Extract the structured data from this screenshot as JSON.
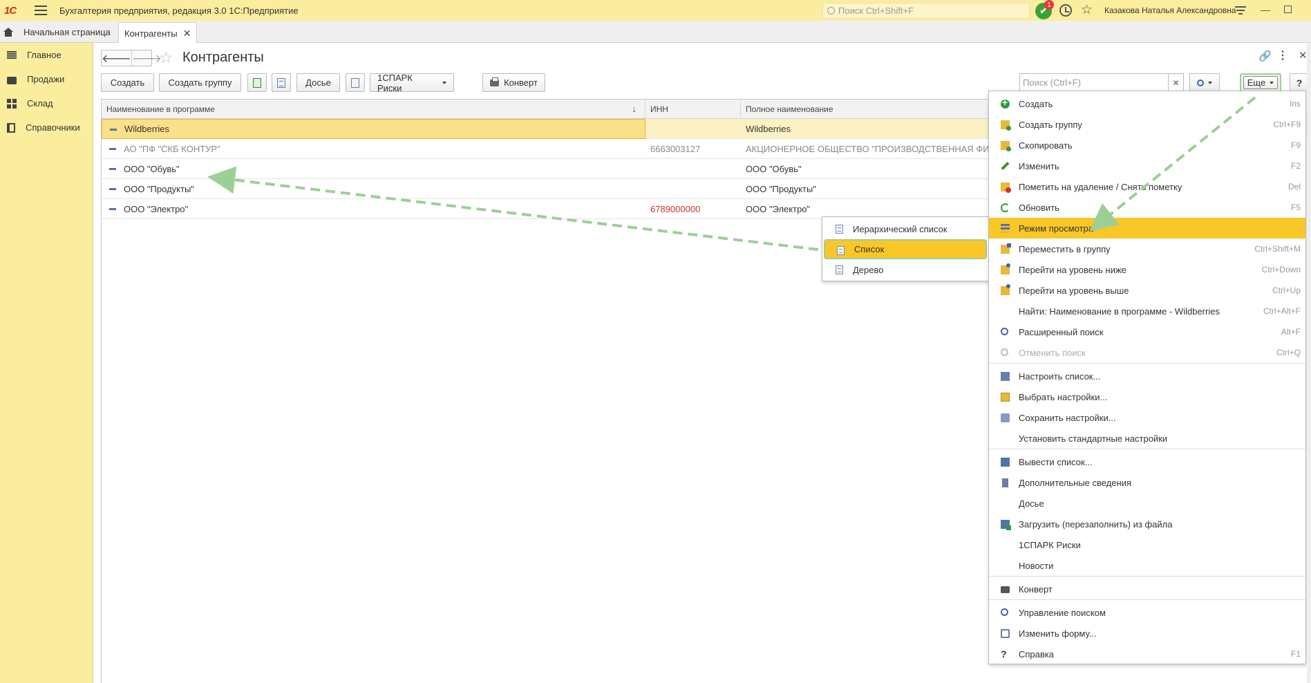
{
  "app": {
    "logo": "1С",
    "title": "Бухгалтерия предприятия, редакция 3.0 1С:Предприятие",
    "search_placeholder": "Поиск Ctrl+Shift+F",
    "notifications_count": "1",
    "user_name": "Казакова Наталья Александровна"
  },
  "tabs": {
    "home": "Начальная страница",
    "active": "Контрагенты"
  },
  "sidebar": {
    "items": [
      {
        "label": "Главное",
        "icon": "menu-icon"
      },
      {
        "label": "Продажи",
        "icon": "bag-icon"
      },
      {
        "label": "Склад",
        "icon": "grid-icon"
      },
      {
        "label": "Справочники",
        "icon": "book-icon"
      }
    ]
  },
  "form": {
    "title": "Контрагенты",
    "toolbar": {
      "create": "Создать",
      "create_group": "Создать группу",
      "dossier": "Досье",
      "spark": "1СПАРК Риски",
      "envelope": "Конверт",
      "search_placeholder": "Поиск (Ctrl+F)",
      "more": "Еще",
      "help": "?"
    }
  },
  "table": {
    "columns": [
      "Наименование в программе",
      "ИНН",
      "Полное наименование"
    ],
    "rows": [
      {
        "name": "Wildberries",
        "inn": "",
        "full_name": "Wildberries",
        "selected": true
      },
      {
        "name": "АО \"ПФ \"СКБ КОНТУР\"",
        "inn": "6663003127",
        "full_name": "АКЦИОНЕРНОЕ ОБЩЕСТВО \"ПРОИЗВОДСТВЕННАЯ ФИ",
        "deleted": true
      },
      {
        "name": "ООО \"Обувь\"",
        "inn": "",
        "full_name": "ООО \"Обувь\""
      },
      {
        "name": "ООО \"Продукты\"",
        "inn": "",
        "full_name": "ООО \"Продукты\""
      },
      {
        "name": "ООО \"Электро\"",
        "inn": "6789000000",
        "full_name": "ООО \"Электро\"",
        "inn_error": true
      }
    ]
  },
  "view_mode_menu": {
    "items": [
      "Иерархический список",
      "Список",
      "Дерево"
    ],
    "active": "Список"
  },
  "more_menu": {
    "items": [
      {
        "label": "Создать",
        "shortcut": "Ins",
        "icon": "create-icon"
      },
      {
        "label": "Создать группу",
        "shortcut": "Ctrl+F9",
        "icon": "create-group-icon"
      },
      {
        "label": "Скопировать",
        "shortcut": "F9",
        "icon": "copy-icon"
      },
      {
        "label": "Изменить",
        "shortcut": "F2",
        "icon": "edit-icon"
      },
      {
        "label": "Пометить на удаление / Снять пометку",
        "shortcut": "Del",
        "icon": "delete-mark-icon"
      },
      {
        "label": "Обновить",
        "shortcut": "F5",
        "icon": "refresh-icon"
      },
      {
        "label": "Режим просмотра",
        "shortcut": "",
        "icon": "view-mode-icon",
        "highlight": true
      },
      {
        "label": "Переместить в группу",
        "shortcut": "Ctrl+Shift+M",
        "icon": "move-group-icon"
      },
      {
        "label": "Перейти на уровень ниже",
        "shortcut": "Ctrl+Down",
        "icon": "level-down-icon"
      },
      {
        "label": "Перейти на уровень выше",
        "shortcut": "Ctrl+Up",
        "icon": "level-up-icon"
      },
      {
        "label": "Найти: Наименование в программе - Wildberries",
        "shortcut": "Ctrl+Alt+F",
        "icon": ""
      },
      {
        "label": "Расширенный поиск",
        "shortcut": "Alt+F",
        "icon": "search-ext-icon"
      },
      {
        "label": "Отменить поиск",
        "shortcut": "Ctrl+Q",
        "icon": "search-cancel-icon",
        "disabled": true
      },
      {
        "label": "Настроить список...",
        "shortcut": "",
        "icon": "list-settings-icon"
      },
      {
        "label": "Выбрать настройки...",
        "shortcut": "",
        "icon": "select-settings-icon"
      },
      {
        "label": "Сохранить настройки...",
        "shortcut": "",
        "icon": "save-settings-icon"
      },
      {
        "label": "Установить стандартные настройки",
        "shortcut": "",
        "icon": ""
      },
      {
        "label": "Вывести список...",
        "shortcut": "",
        "icon": "output-list-icon"
      },
      {
        "label": "Дополнительные сведения",
        "shortcut": "",
        "icon": "extra-info-icon"
      },
      {
        "label": "Досье",
        "shortcut": "",
        "icon": ""
      },
      {
        "label": "Загрузить (перезаполнить) из файла",
        "shortcut": "",
        "icon": "load-file-icon"
      },
      {
        "label": "1СПАРК Риски",
        "shortcut": "",
        "icon": ""
      },
      {
        "label": "Новости",
        "shortcut": "",
        "icon": ""
      },
      {
        "label": "Конверт",
        "shortcut": "",
        "icon": "envelope-icon"
      },
      {
        "label": "Управление поиском",
        "shortcut": "",
        "icon": "search-manage-icon"
      },
      {
        "label": "Изменить форму...",
        "shortcut": "",
        "icon": "form-edit-icon"
      },
      {
        "label": "Справка",
        "shortcut": "F1",
        "icon": "help-icon"
      }
    ]
  },
  "colors": {
    "panel_yellow": "#fbed9e",
    "highlight": "#f9c727",
    "annotation_green": "#9ccf95",
    "error_red": "#d32f2f"
  }
}
